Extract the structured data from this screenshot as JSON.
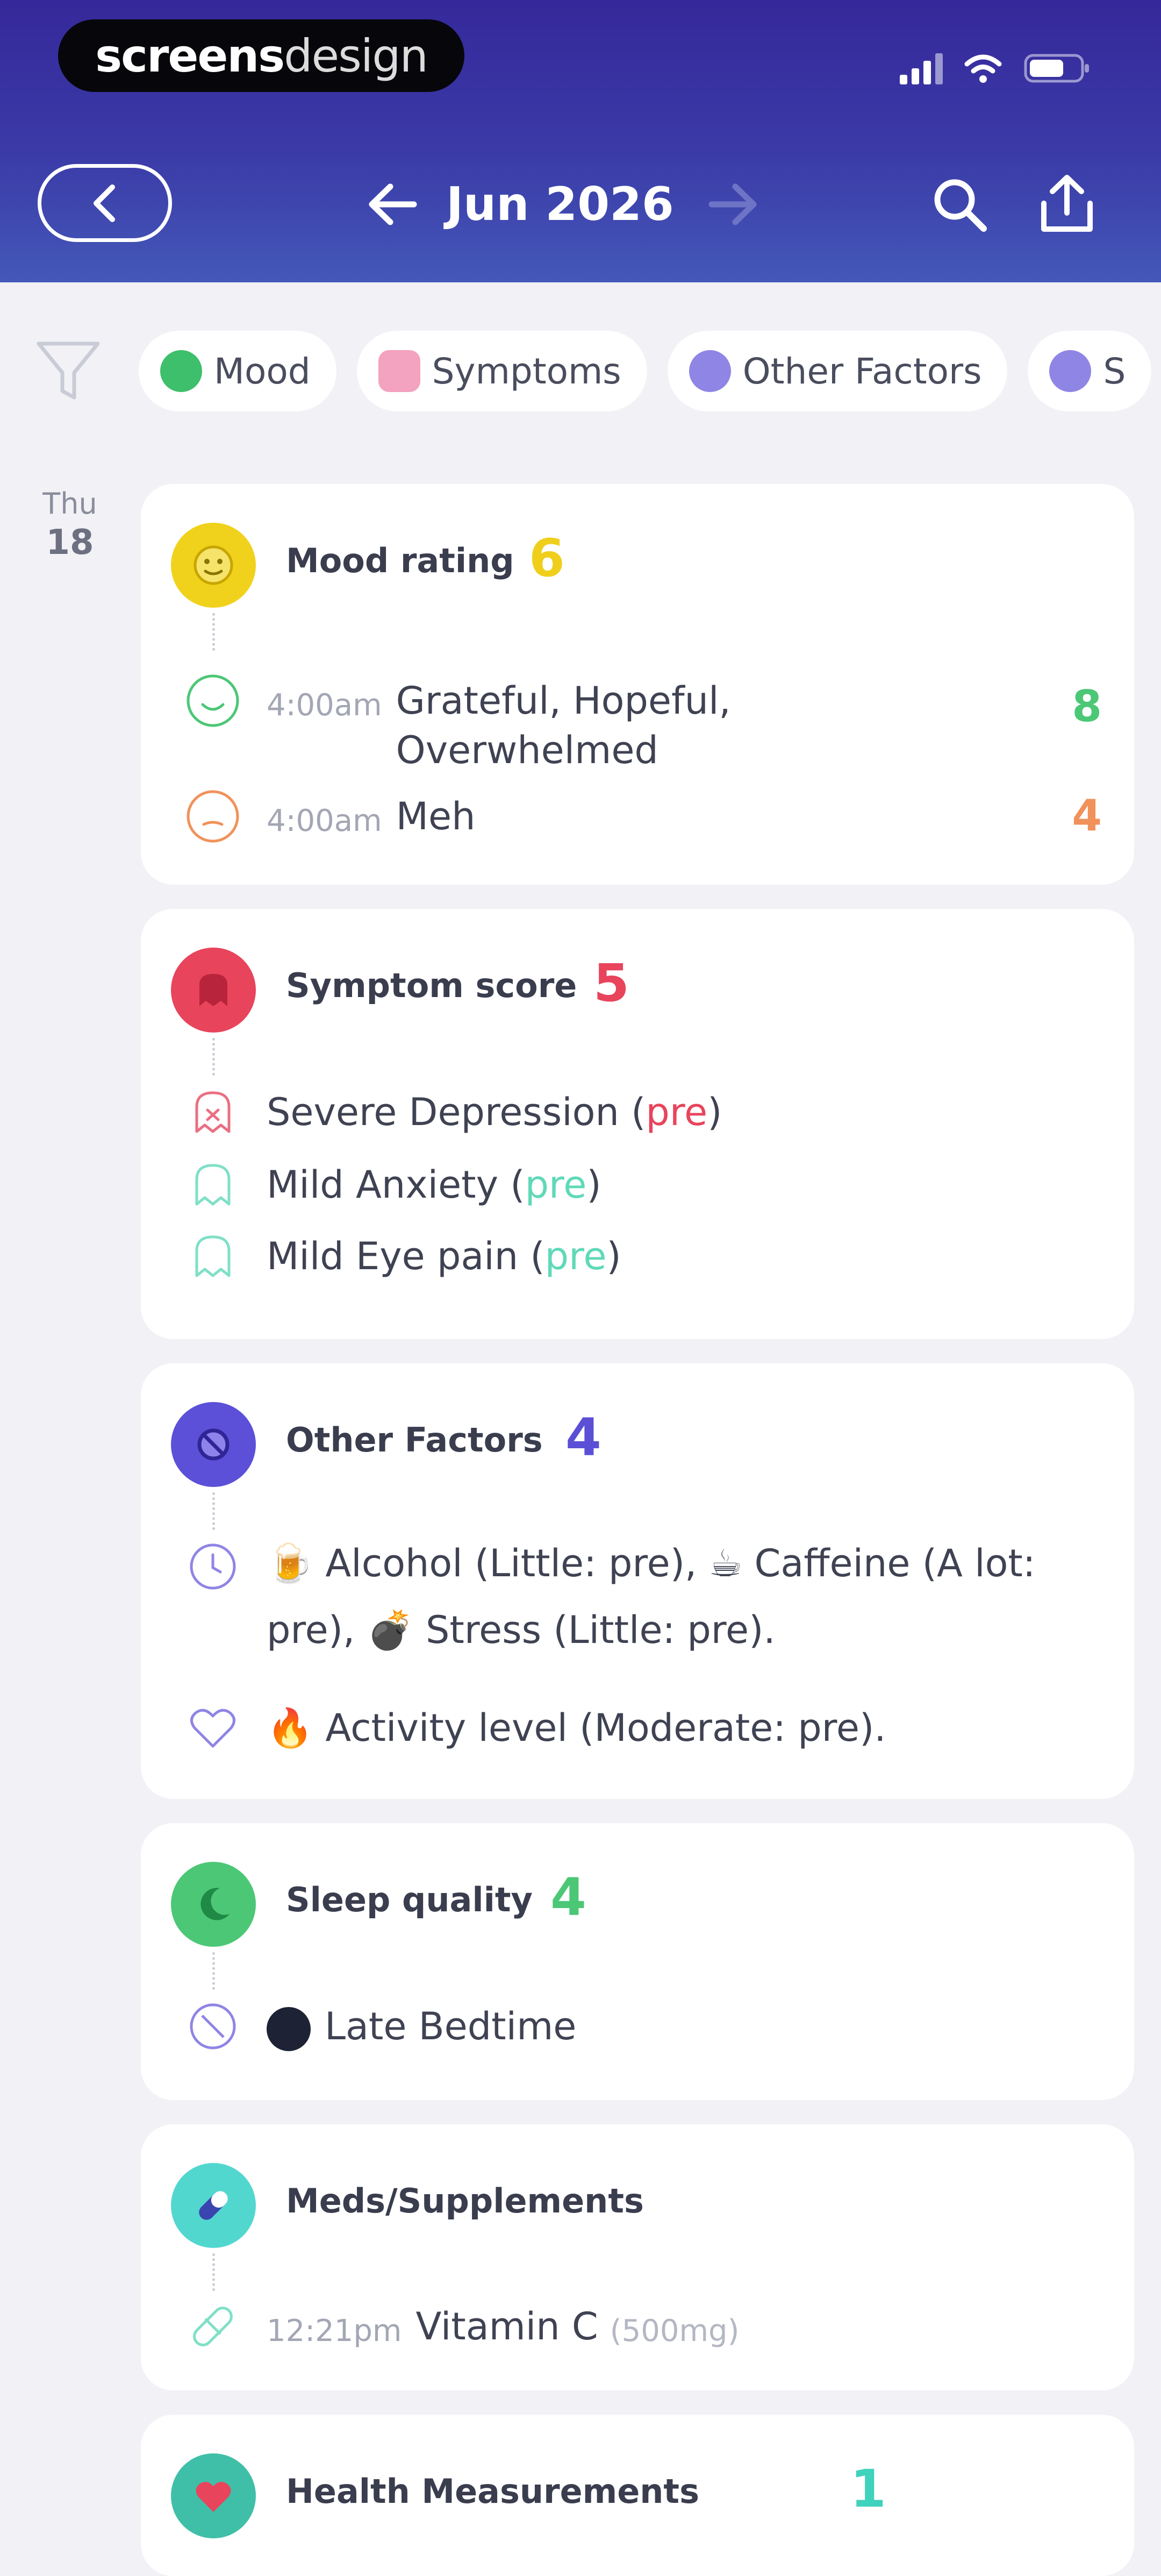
{
  "header": {
    "brand_bold": "screens",
    "brand_light": "design",
    "month_label": "Jun 2026"
  },
  "filters": [
    {
      "label": "Mood",
      "color": "#3dbf6b"
    },
    {
      "label": "Symptoms",
      "color": "#e95b8c"
    },
    {
      "label": "Other Factors",
      "color": "#6c5fd8"
    },
    {
      "label": "S",
      "color": "#6c5fd8"
    }
  ],
  "date": {
    "weekday": "Thu",
    "day": "18"
  },
  "cards": {
    "mood": {
      "title": "Mood rating",
      "score": "6",
      "score_color": "#f0cf1c",
      "entries": [
        {
          "time": "4:00am",
          "text": "Grateful, Hopeful, Overwhelmed",
          "value": "8",
          "color": "#4cc776"
        },
        {
          "time": "4:00am",
          "text": "Meh",
          "value": "4",
          "color": "#f0925a"
        }
      ]
    },
    "symptom": {
      "title": "Symptom score",
      "score": "5",
      "score_color": "#e8445c",
      "entries": [
        {
          "name": "Severe Depression",
          "tag": "pre",
          "tag_color": "#e8445c"
        },
        {
          "name": "Mild Anxiety",
          "tag": "pre",
          "tag_color": "#5fd9b8"
        },
        {
          "name": "Mild Eye pain",
          "tag": "pre",
          "tag_color": "#5fd9b8"
        }
      ]
    },
    "factors": {
      "title": "Other Factors",
      "score": "4",
      "score_color": "#5b4fd6",
      "line1": "🍺 Alcohol (Little: pre), ☕ Caffeine (A lot: pre), 💣 Stress (Little: pre).",
      "line2": "🔥 Activity level (Moderate: pre)."
    },
    "sleep": {
      "title": "Sleep quality",
      "score": "4",
      "score_color": "#4cc776",
      "entry": "Late Bedtime"
    },
    "meds": {
      "title": "Meds/Supplements",
      "time": "12:21pm",
      "name": "Vitamin C",
      "dose": "(500mg)"
    },
    "health": {
      "title": "Health Measurements",
      "score": "1",
      "score_color": "#3fd2bd"
    }
  }
}
